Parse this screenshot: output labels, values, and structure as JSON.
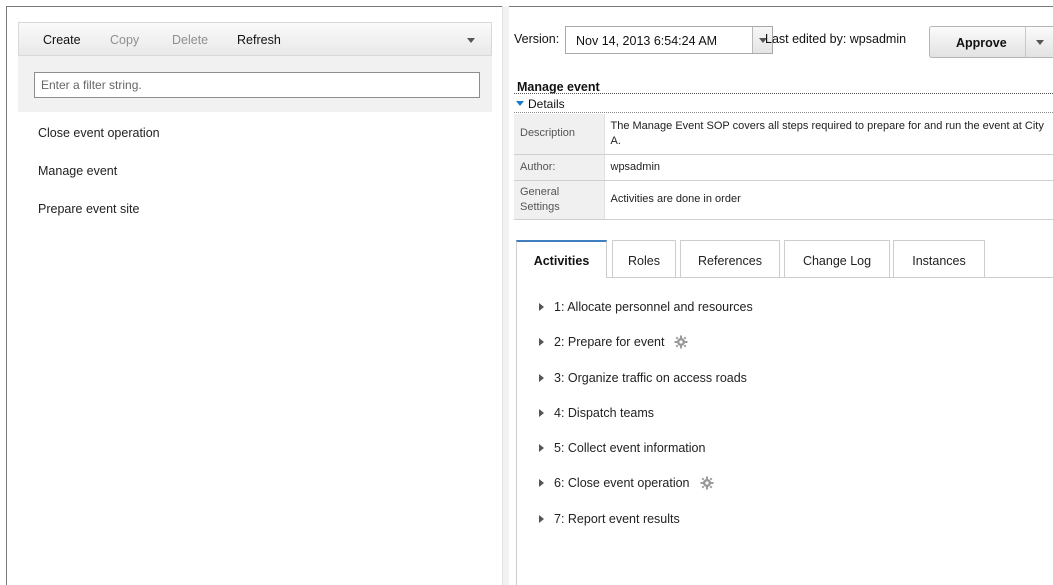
{
  "toolbar": {
    "create": "Create",
    "copy": "Copy",
    "delete": "Delete",
    "refresh": "Refresh"
  },
  "filter": {
    "placeholder": "Enter a filter string."
  },
  "sop_list": [
    "Close event operation",
    "Manage event",
    "Prepare event site"
  ],
  "version": {
    "label": "Version:",
    "value": "Nov 14, 2013 6:54:24 AM",
    "last_edited": "Last edited by: wpsadmin",
    "approve": "Approve"
  },
  "sop": {
    "title": "Manage event",
    "details_label": "Details",
    "details": [
      {
        "key": "Description",
        "value": "The Manage Event SOP covers all steps required to prepare for and run the event at City A."
      },
      {
        "key": "Author:",
        "value": "wpsadmin"
      },
      {
        "key": "General Settings",
        "value": "Activities are done in order"
      }
    ]
  },
  "tabs": [
    "Activities",
    "Roles",
    "References",
    "Change Log",
    "Instances"
  ],
  "active_tab": "Activities",
  "activities": [
    {
      "label": "1: Allocate personnel and resources",
      "gear": false
    },
    {
      "label": "2: Prepare for event",
      "gear": true
    },
    {
      "label": "3: Organize traffic on access roads",
      "gear": false
    },
    {
      "label": "4: Dispatch teams",
      "gear": false
    },
    {
      "label": "5: Collect event information",
      "gear": false
    },
    {
      "label": "6: Close event operation",
      "gear": true
    },
    {
      "label": "7: Report event results",
      "gear": false
    }
  ],
  "colors": {
    "tab_accent": "#3f7fbf",
    "details_triangle": "#1a7ac8"
  }
}
